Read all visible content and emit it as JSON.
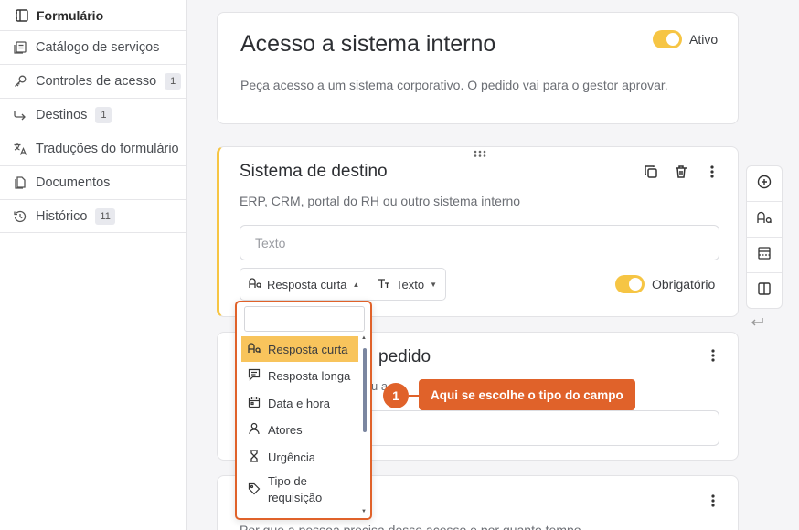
{
  "sidebar": {
    "header": {
      "label": "Formulário",
      "icon": "form-icon"
    },
    "items": [
      {
        "label": "Catálogo de serviços",
        "icon": "catalog-icon",
        "badge": ""
      },
      {
        "label": "Controles de acesso",
        "icon": "key-icon",
        "badge": "1"
      },
      {
        "label": "Destinos",
        "icon": "redirect-arrow-icon",
        "badge": "1"
      },
      {
        "label": "Traduções do formulário",
        "icon": "translate-icon",
        "badge": ""
      },
      {
        "label": "Documentos",
        "icon": "documents-icon",
        "badge": ""
      },
      {
        "label": "Histórico",
        "icon": "history-icon",
        "badge": "11"
      }
    ]
  },
  "form": {
    "title": "Acesso a sistema interno",
    "description": "Peça acesso a um sistema corporativo. O pedido vai para o gestor aprovar.",
    "active_label": "Ativo",
    "active": true
  },
  "question1": {
    "title": "Sistema de destino",
    "description": "ERP, CRM, portal do RH ou outro sistema interno",
    "placeholder": "Texto",
    "type_label": "Resposta curta",
    "format_label": "Texto",
    "required_label": "Obrigatório",
    "required": true
  },
  "question2": {
    "title_fragment": "pedido",
    "description_fragment": "u a"
  },
  "question3": {
    "description": "Por que a pessoa precisa desse acesso e por quanto tempo"
  },
  "dropdown": {
    "options": [
      {
        "label": "Resposta curta",
        "icon": "short-answer-icon",
        "selected": true
      },
      {
        "label": "Resposta longa",
        "icon": "long-answer-icon",
        "selected": false
      },
      {
        "label": "Data e hora",
        "icon": "calendar-icon",
        "selected": false
      },
      {
        "label": "Atores",
        "icon": "person-icon",
        "selected": false
      },
      {
        "label": "Urgência",
        "icon": "hourglass-icon",
        "selected": false
      },
      {
        "label": "Tipo de requisição",
        "icon": "tag-icon",
        "selected": false
      }
    ]
  },
  "callout": {
    "number": "1",
    "text": "Aqui se escolhe o tipo do campo"
  },
  "colors": {
    "accent": "#f6c544",
    "callout": "#e0622a",
    "selected_option": "#f8c45c"
  }
}
